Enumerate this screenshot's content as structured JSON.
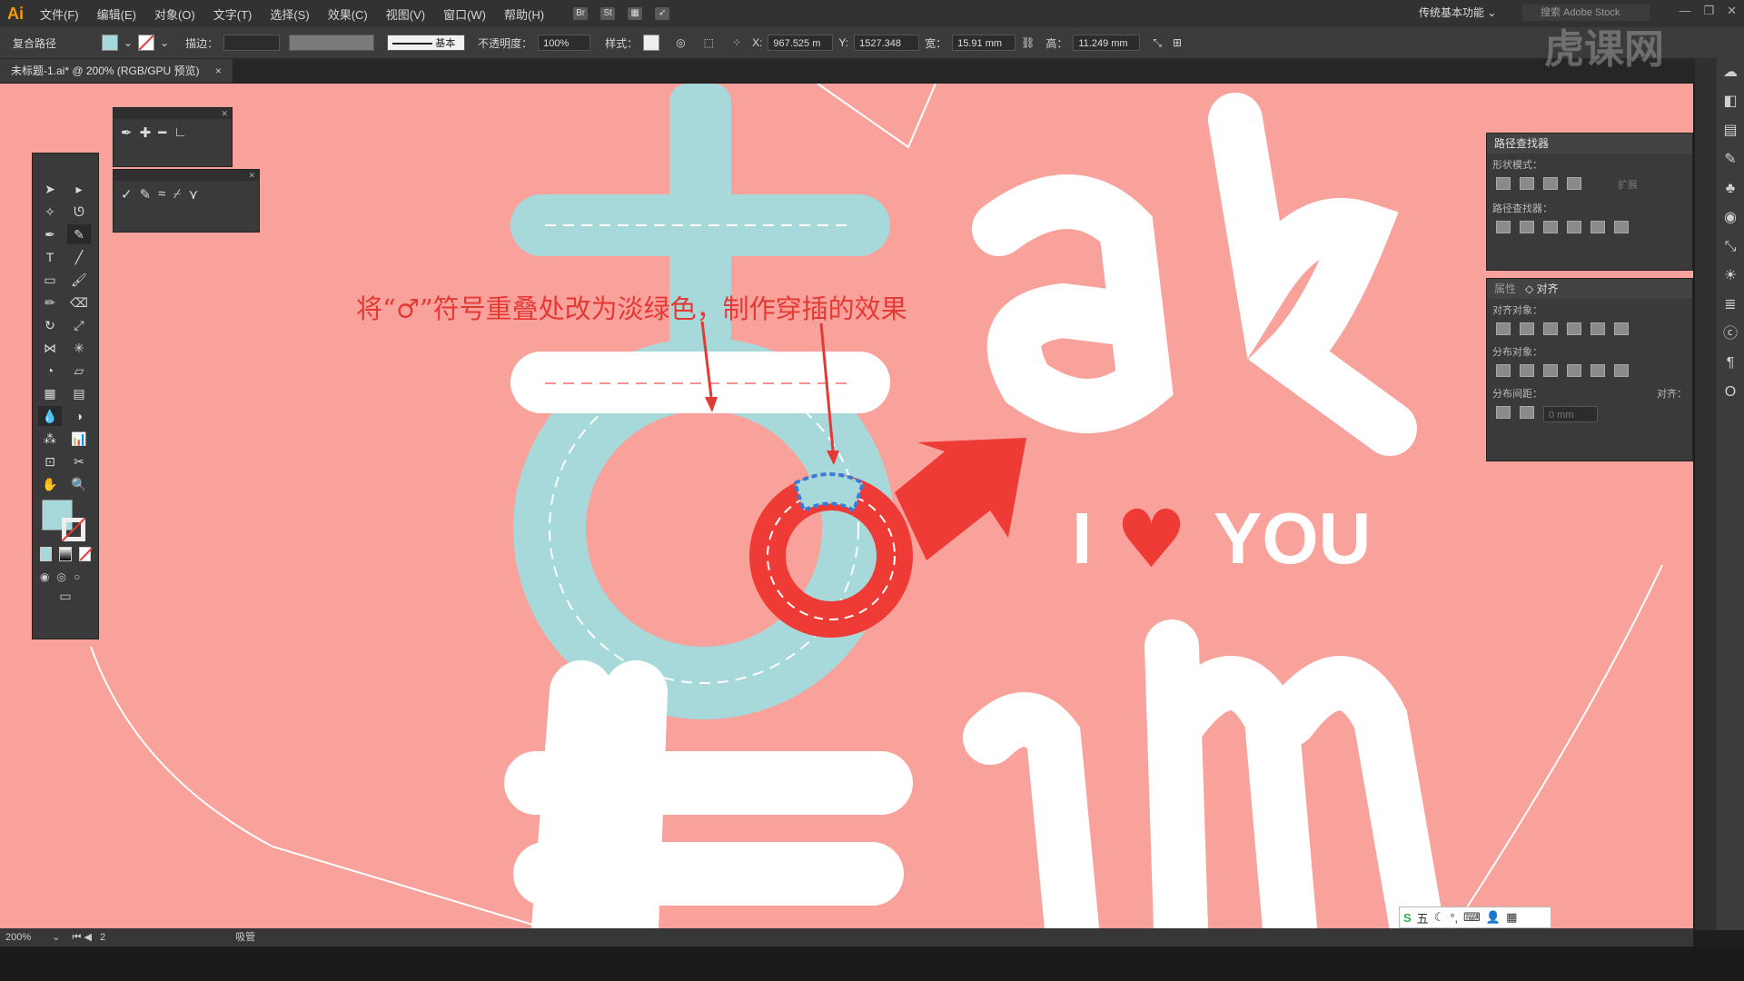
{
  "app": {
    "logo": "Ai"
  },
  "menu": [
    "文件(F)",
    "编辑(E)",
    "对象(O)",
    "文字(T)",
    "选择(S)",
    "效果(C)",
    "视图(V)",
    "窗口(W)",
    "帮助(H)"
  ],
  "menu_icons": [
    "Br",
    "St",
    "layout-icon",
    "rocket-icon"
  ],
  "workspace": "传统基本功能",
  "stock_search_placeholder": "搜索 Adobe Stock",
  "controlbar": {
    "object_type": "复合路径",
    "stroke_label": "描边：",
    "stroke_profile": "基本",
    "opacity_label": "不透明度：",
    "opacity_value": "100%",
    "style_label": "样式：",
    "x_label": "X:",
    "x_value": "967.525 m",
    "y_label": "Y:",
    "y_value": "1527.348",
    "w_label": "宽：",
    "w_value": "15.91 mm",
    "h_label": "高：",
    "h_value": "11.249 mm"
  },
  "document_tab": {
    "title": "未标题-1.ai* @ 200% (RGB/GPU 预览)",
    "close": "×"
  },
  "annotation": "将“♂”符号重叠处改为淡绿色，制作穿插的效果",
  "artwork": {
    "i_love_you_i": "I",
    "i_love_you_you": "YOU",
    "heart": "♥"
  },
  "colors": {
    "fill": "#a7d9db",
    "canvas": "#f9a19b",
    "red": "#ef3b36",
    "white": "#ffffff"
  },
  "panels": {
    "pathfinder": {
      "title": "路径查找器",
      "shape_modes": "形状模式：",
      "expand": "扩展",
      "pathfinders": "路径查找器："
    },
    "align": {
      "tab_properties": "属性",
      "tab_align": "◇ 对齐",
      "align_objects": "对齐对象：",
      "distribute_objects": "分布对象：",
      "distribute_spacing": "分布间距：",
      "align_to": "对齐：",
      "spacing_value": "0 mm"
    }
  },
  "statusbar": {
    "zoom": "200%",
    "page": "2",
    "tool": "吸管"
  },
  "ime": {
    "text": "五"
  },
  "watermark": "虎课网"
}
